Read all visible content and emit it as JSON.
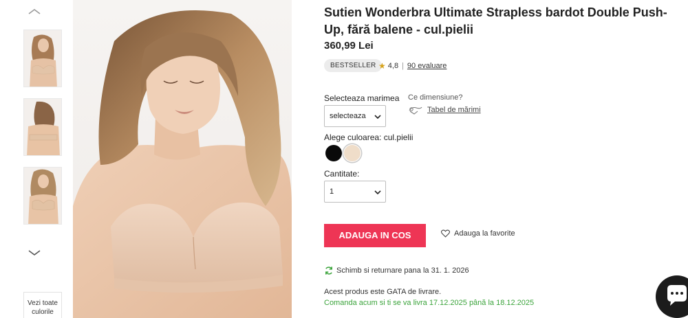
{
  "gallery": {
    "up_icon": "chevron-up-icon",
    "down_icon": "chevron-down-icon",
    "see_all": "Vezi toate culorile"
  },
  "product": {
    "title": "Sutien Wonderbra Ultimate Strapless bardot Double Push-Up, fără balene - cul.pielii",
    "price": "360,99 Lei",
    "badge": "BESTSELLER",
    "rating": "4,8",
    "reviews": "90 evaluare"
  },
  "size": {
    "label": "Selecteaza marimea",
    "value": "selecteaza",
    "help": "Ce dimensiune?",
    "chart_link": "Tabel de mărimi"
  },
  "color": {
    "label": "Alege culoarea: cul.pielii",
    "swatches": [
      {
        "name": "negru",
        "hex": "#0a0a0a"
      },
      {
        "name": "cul.pielii",
        "hex": "#efddc9"
      }
    ]
  },
  "quantity": {
    "label": "Cantitate:",
    "value": "1"
  },
  "actions": {
    "add_to_cart": "ADAUGA IN COS",
    "favorite": "Adauga la favorite"
  },
  "info": {
    "returns": "Schimb si returnare pana la 31. 1. 2026",
    "stock": "Acest produs este GATA de livrare.",
    "delivery": "Comanda acum si ti se va livra 17.12.2025 până la 18.12.2025"
  },
  "colors": {
    "accent": "#ee3555",
    "success": "#3aa33a",
    "star": "#d6a21a"
  }
}
